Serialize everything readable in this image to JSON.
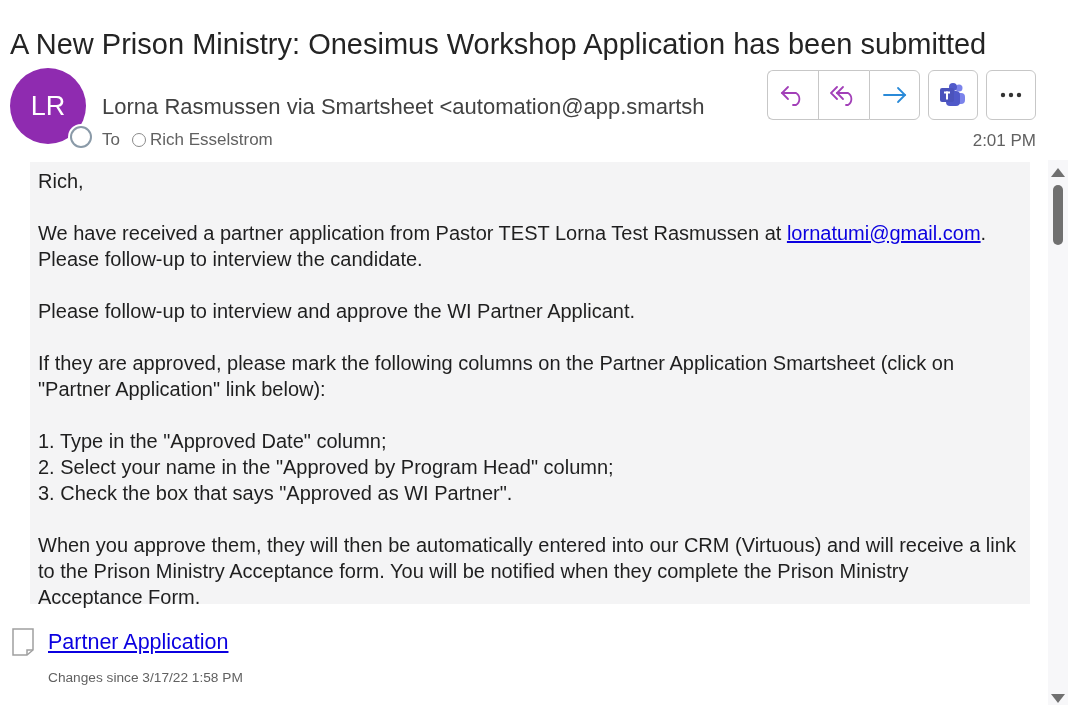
{
  "subject": "A New Prison Ministry: Onesimus Workshop Application has been submitted",
  "sender": {
    "initials": "LR",
    "from": "Lorna Rasmussen via Smartsheet <automation@app.smartsh",
    "to_label": "To",
    "recipient": "Rich Esselstrom",
    "time": "2:01 PM"
  },
  "body": [
    {
      "parts": [
        {
          "kind": "text",
          "text": "Rich,"
        }
      ]
    },
    {
      "parts": [
        {
          "kind": "text",
          "text": "We have received a partner application from Pastor TEST Lorna Test Rasmussen at "
        },
        {
          "kind": "link",
          "text": "lornatumi@gmail.com"
        },
        {
          "kind": "text",
          "text": ".\nPlease follow-up to interview the candidate."
        }
      ]
    },
    {
      "parts": [
        {
          "kind": "text",
          "text": "Please follow-up to interview and approve the WI Partner Applicant."
        }
      ]
    },
    {
      "parts": [
        {
          "kind": "text",
          "text": "If they are approved, please mark the following columns on the Partner Application Smartsheet (click on\n\"Partner Application\" link below):"
        }
      ]
    },
    {
      "parts": [
        {
          "kind": "text",
          "text": "1. Type in the \"Approved Date\" column;\n2. Select your name in the \"Approved by Program Head\" column;\n3. Check the box that says \"Approved as WI Partner\"."
        }
      ]
    },
    {
      "parts": [
        {
          "kind": "text",
          "text": "When you approve them, they will then be automatically entered into our CRM (Virtuous) and will receive a link\nto the Prison Ministry Acceptance form. You will be notified when they complete the Prison Ministry\nAcceptance Form."
        }
      ]
    }
  ],
  "attachment": {
    "link": "Partner Application",
    "note": "Changes since 3/17/22 1:58 PM"
  }
}
